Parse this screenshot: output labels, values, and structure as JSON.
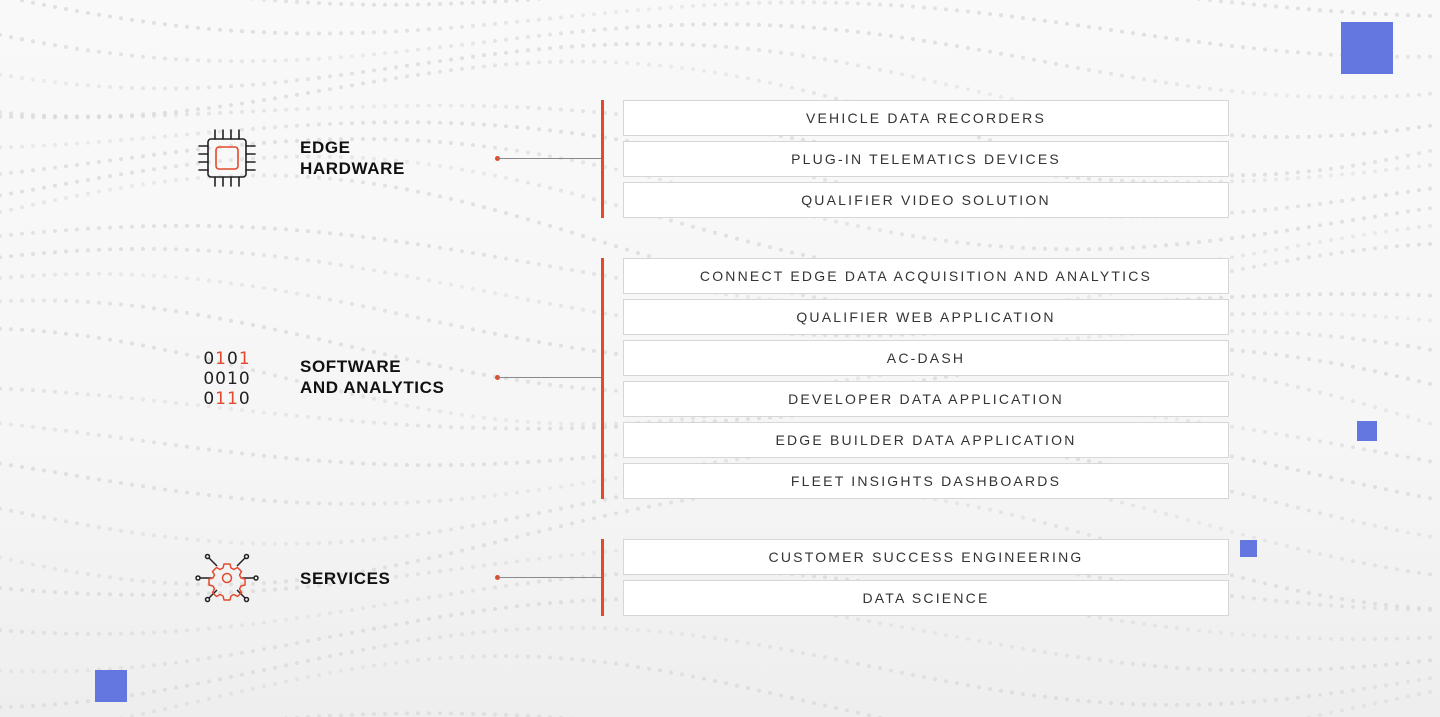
{
  "colors": {
    "accent": "#e34a2c",
    "square": "#6477e0",
    "box_border": "#d6d6d6",
    "connector_line": "#8a8a8a",
    "dots": "#d9d9d9"
  },
  "groups": [
    {
      "id": "edge-hardware",
      "icon": "chip-icon",
      "title_lines": [
        "EDGE",
        "HARDWARE"
      ],
      "items": [
        "VEHICLE DATA RECORDERS",
        "PLUG-IN TELEMATICS DEVICES",
        "QUALIFIER VIDEO SOLUTION"
      ]
    },
    {
      "id": "software-analytics",
      "icon": "binary-code-icon",
      "title_lines": [
        "SOFTWARE",
        "AND ANALYTICS"
      ],
      "binary_rows": [
        [
          {
            "d": "0",
            "hi": false
          },
          {
            "d": "1",
            "hi": true
          },
          {
            "d": "0",
            "hi": false
          },
          {
            "d": "1",
            "hi": true
          }
        ],
        [
          {
            "d": "0",
            "hi": false
          },
          {
            "d": "0",
            "hi": false
          },
          {
            "d": "1",
            "hi": false
          },
          {
            "d": "0",
            "hi": false
          }
        ],
        [
          {
            "d": "0",
            "hi": false
          },
          {
            "d": "1",
            "hi": true
          },
          {
            "d": "1",
            "hi": true
          },
          {
            "d": "0",
            "hi": false
          }
        ]
      ],
      "items": [
        "CONNECT EDGE DATA ACQUISITION AND ANALYTICS",
        "QUALIFIER WEB APPLICATION",
        "AC-DASH",
        "DEVELOPER DATA APPLICATION",
        "EDGE BUILDER DATA APPLICATION",
        "FLEET INSIGHTS DASHBOARDS"
      ]
    },
    {
      "id": "services",
      "icon": "gear-network-icon",
      "title_lines": [
        "SERVICES"
      ],
      "items": [
        "CUSTOMER SUCCESS ENGINEERING",
        "DATA SCIENCE"
      ]
    }
  ]
}
